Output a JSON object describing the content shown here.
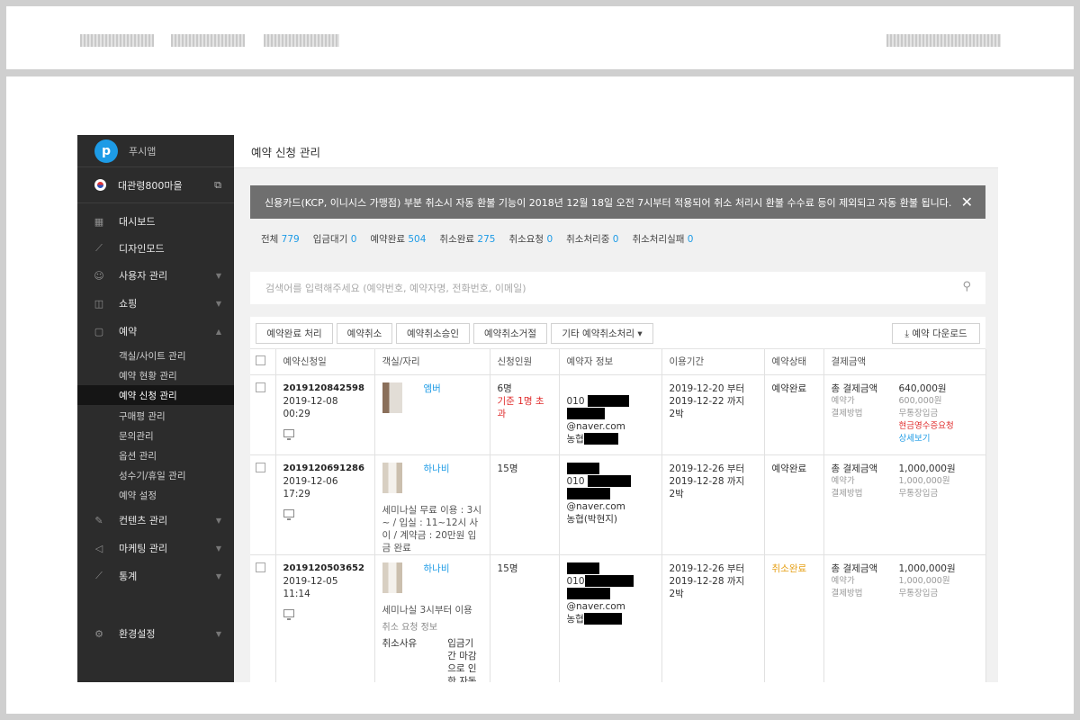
{
  "sidebar": {
    "brand": "푸시앱",
    "site": "대관령800마을",
    "nav": [
      {
        "icon": "dashboard-icon",
        "glyph": "▦",
        "label": "대시보드"
      },
      {
        "icon": "wand-icon",
        "glyph": "⟋",
        "label": "디자인모드"
      },
      {
        "icon": "user-icon",
        "glyph": "☺",
        "label": "사용자 관리"
      },
      {
        "icon": "bag-icon",
        "glyph": "◫",
        "label": "쇼핑"
      },
      {
        "icon": "calendar-icon",
        "glyph": "▢",
        "label": "예약"
      }
    ],
    "sub": [
      "객실/사이트 관리",
      "예약 현황 관리",
      "예약 신청 관리",
      "구매평 관리",
      "문의관리",
      "옵션 관리",
      "성수기/휴일 관리",
      "예약 설정"
    ],
    "nav2": [
      {
        "icon": "edit-icon",
        "glyph": "✎",
        "label": "컨텐츠 관리"
      },
      {
        "icon": "megaphone-icon",
        "glyph": "◁",
        "label": "마케팅 관리"
      },
      {
        "icon": "chart-icon",
        "glyph": "⟋",
        "label": "통계"
      },
      {
        "icon": "gear-icon",
        "glyph": "⚙",
        "label": "환경설정"
      }
    ]
  },
  "page": {
    "title": "예약 신청 관리",
    "notice": "신용카드(KCP, 이니시스 가맹점) 부분 취소시 자동 환불 기능이 2018년 12월 18일 오전 7시부터 적용되어 취소 처리시 환불 수수료 등이 제외되고 자동 환불 됩니다.",
    "stats": [
      {
        "label": "전체",
        "count": "779"
      },
      {
        "label": "입금대기",
        "count": "0"
      },
      {
        "label": "예약완료",
        "count": "504"
      },
      {
        "label": "취소완료",
        "count": "275"
      },
      {
        "label": "취소요청",
        "count": "0"
      },
      {
        "label": "취소처리중",
        "count": "0"
      },
      {
        "label": "취소처리실패",
        "count": "0"
      }
    ],
    "search_placeholder": "검색어를 입력해주세요 (예약번호, 예약자명, 전화번호, 이메일)",
    "toolbar": {
      "complete": "예약완료 처리",
      "cancel": "예약취소",
      "cancel_approve": "예약취소승인",
      "cancel_reject": "예약취소거절",
      "other": "기타 예약취소처리 ▾",
      "download": "⤓ 예약 다운로드"
    },
    "columns": [
      "예약신청일",
      "객실/자리",
      "신청인원",
      "예약자 정보",
      "이용기간",
      "예약상태",
      "결제금액"
    ]
  },
  "rows": [
    {
      "id": "2019120842598",
      "date": "2019-12-08 00:29",
      "room": "엠버",
      "desc": "",
      "people": "6명",
      "over": "기준 1명 초과",
      "phone_prefix": "010",
      "email_suffix": "@naver.com",
      "bank": "농협",
      "start": "2019-12-20 부터",
      "end": "2019-12-22 까지",
      "nights": "2박",
      "status": "예약완료",
      "total_label": "총 결제금액",
      "total": "640,000원",
      "price_label": "예약가",
      "price": "600,000원",
      "method_label": "결제방법",
      "method": "무통장입금",
      "receipt": "현금영수증요청",
      "detail": "상세보기"
    },
    {
      "id": "2019120691286",
      "date": "2019-12-06 17:29",
      "room": "하나비",
      "desc": "세미나실 무료 이용 : 3시~ / 입실 : 11~12시 사이 / 계약금 : 20만원 입금 완료",
      "people": "15명",
      "phone_prefix": "010",
      "email_suffix": "@naver.com",
      "bank": "농협(박현지)",
      "start": "2019-12-26 부터",
      "end": "2019-12-28 까지",
      "nights": "2박",
      "status": "예약완료",
      "total_label": "총 결제금액",
      "total": "1,000,000원",
      "price_label": "예약가",
      "price": "1,000,000원",
      "method_label": "결제방법",
      "method": "무통장입금"
    },
    {
      "id": "2019120503652",
      "date": "2019-12-05 11:14",
      "room": "하나비",
      "desc": "세미나실 3시부터 이용",
      "cancel_info": "취소 요청 정보",
      "cancel_reason_label": "취소사유",
      "cancel_reason": "입금기간 마감으로 인한 자동취소",
      "people": "15명",
      "phone_prefix": "010",
      "email_suffix": "@naver.com",
      "bank": "농협",
      "start": "2019-12-26 부터",
      "end": "2019-12-28 까지",
      "nights": "2박",
      "status": "취소완료",
      "total_label": "총 결제금액",
      "total": "1,000,000원",
      "price_label": "예약가",
      "price": "1,000,000원",
      "method_label": "결제방법",
      "method": "무통장입금"
    }
  ]
}
